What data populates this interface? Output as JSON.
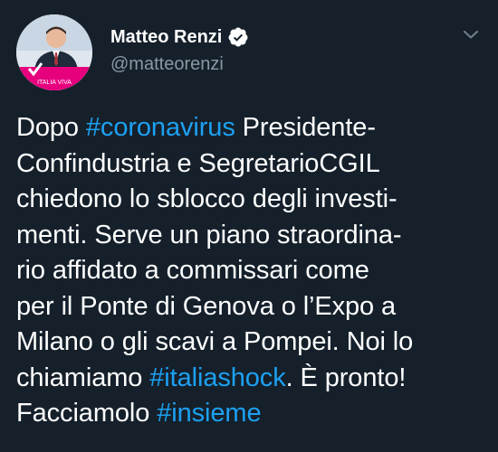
{
  "author": {
    "display_name": "Matteo Renzi",
    "handle": "@matteorenzi",
    "verified": true,
    "avatar_badge_text": "ITALIA VIVA"
  },
  "icons": {
    "verified": "verified-badge-icon",
    "more": "chevron-down-icon"
  },
  "colors": {
    "background": "#15202b",
    "text": "#ffffff",
    "secondary_text": "#8899a6",
    "link": "#1da1f2"
  },
  "tweet": {
    "lines": [
      [
        {
          "t": "Dopo "
        },
        {
          "t": "#coronavirus",
          "tag": true
        },
        {
          "t": " Presidente-"
        }
      ],
      [
        {
          "t": "Confindustria e SegretarioCGIL"
        }
      ],
      [
        {
          "t": "chiedono lo sblocco degli investi-"
        }
      ],
      [
        {
          "t": "menti. Serve un piano straordina-"
        }
      ],
      [
        {
          "t": "rio affidato a commissari come"
        }
      ],
      [
        {
          "t": "per il Ponte di Genova o l’Expo a"
        }
      ],
      [
        {
          "t": "Milano o gli scavi a Pompei. Noi lo"
        }
      ],
      [
        {
          "t": "chiamiamo "
        },
        {
          "t": "#italiashock",
          "tag": true
        },
        {
          "t": ". È pronto!"
        }
      ],
      [
        {
          "t": "Facciamolo "
        },
        {
          "t": "#insieme",
          "tag": true
        }
      ]
    ]
  }
}
